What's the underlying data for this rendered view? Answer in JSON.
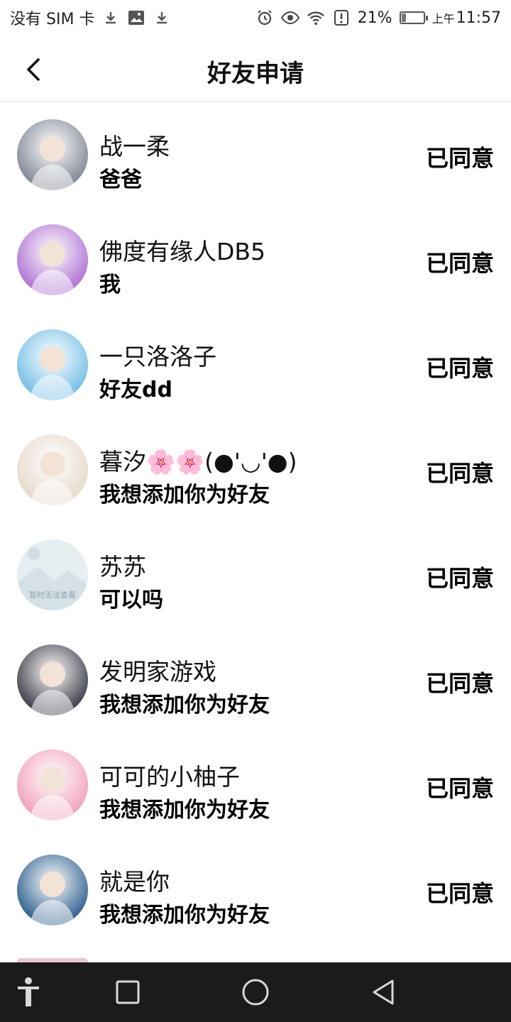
{
  "status_bar": {
    "carrier": "没有 SIM 卡",
    "battery_percent": "21%",
    "time_prefix": "上午",
    "time": "11:57",
    "battery_level": 0.21,
    "icons": [
      "download-icon",
      "image-icon",
      "download-icon",
      "alarm-icon",
      "eye-icon",
      "wifi-icon",
      "alert-icon",
      "battery-icon"
    ]
  },
  "header": {
    "title": "好友申请",
    "back_icon": "chevron-left-icon"
  },
  "requests": [
    {
      "name": "战一柔",
      "message": "爸爸",
      "status": "已同意",
      "avatar_color": "#8a8f9c"
    },
    {
      "name": "佛度有缘人DB5",
      "message": "我",
      "status": "已同意",
      "avatar_color": "#b57ad6"
    },
    {
      "name": "一只洛洛子",
      "message": "好友dd",
      "status": "已同意",
      "avatar_color": "#7ec3e8"
    },
    {
      "name": "暮汐🌸🌸(●'◡'●)",
      "message": "我想添加你为好友",
      "status": "已同意",
      "avatar_color": "#e8dccf"
    },
    {
      "name": "苏苏",
      "message": "可以吗",
      "status": "已同意",
      "avatar_color": "#e3ecf1",
      "placeholder_text": "暂时无法查看"
    },
    {
      "name": "发明家游戏",
      "message": "我想添加你为好友",
      "status": "已同意",
      "avatar_color": "#4a4a55"
    },
    {
      "name": "可可的小柚子",
      "message": "我想添加你为好友",
      "status": "已同意",
      "avatar_color": "#f2a7c0"
    },
    {
      "name": "就是你",
      "message": "我想添加你为好友",
      "status": "已同意",
      "avatar_color": "#3e6b96"
    }
  ],
  "nav_bar": {
    "icons": [
      "accessibility-icon",
      "recents-icon",
      "home-icon",
      "back-icon"
    ]
  }
}
